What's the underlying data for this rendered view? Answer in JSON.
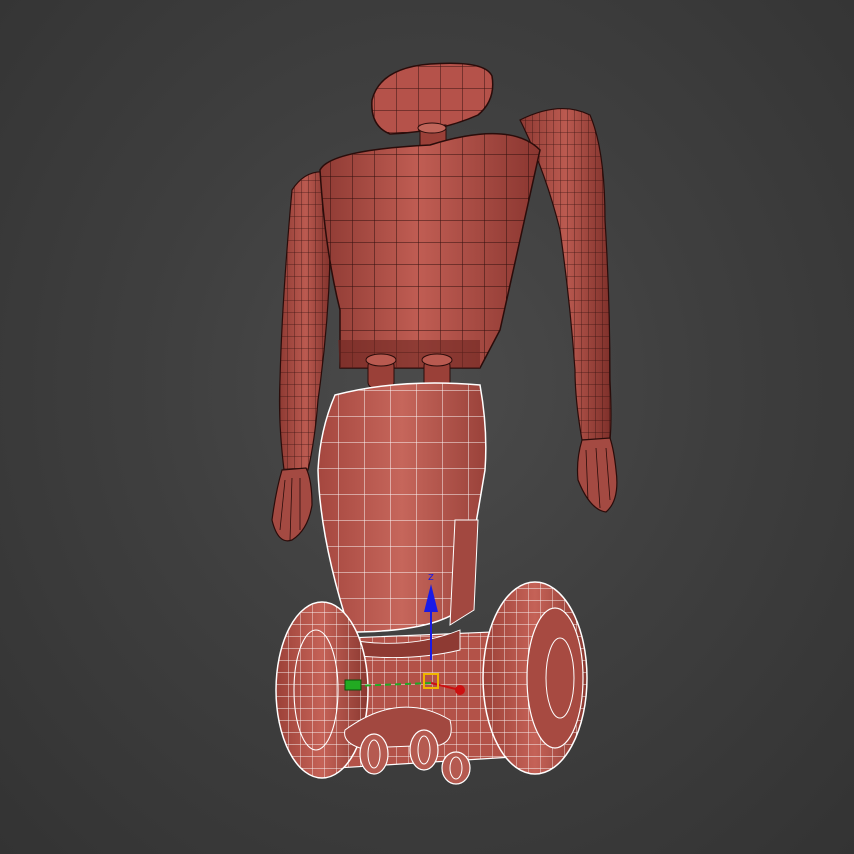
{
  "viewport": {
    "background_color": "#3f3f3f",
    "model": {
      "base_color": "#b5524a",
      "shadow_color": "#7a2e28",
      "highlight_color": "#d0786c",
      "wire_dark_color": "#2a0c0a",
      "wire_selected_color": "#ffffff",
      "selected_part": "base"
    },
    "gizmo": {
      "z_label": "z",
      "z_color": "#1a1ae6",
      "x_color": "#cc1111",
      "y_color": "#22aa22",
      "center_color": "#f0b400"
    }
  }
}
